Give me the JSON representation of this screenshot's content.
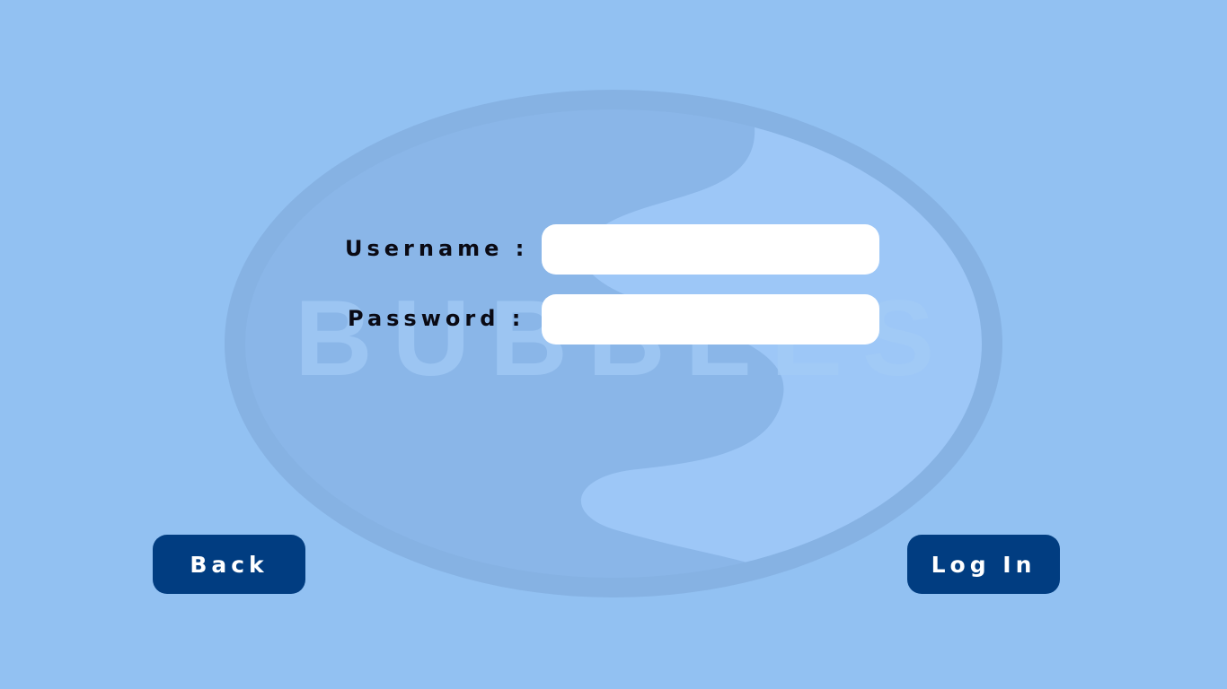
{
  "logo": {
    "wordmark": "BUBBLES"
  },
  "colors": {
    "background": "#92c1f2",
    "logo_ring": "#86b2e3",
    "logo_dark_half": "#8ab6e8",
    "logo_light_half": "#9dc7f7",
    "button": "#013d81",
    "button_text": "#ffffff",
    "field": "#ffffff",
    "label_text": "#0a0a14"
  },
  "login_form": {
    "username_label": "Username :",
    "username_value": "",
    "password_label": "Password :",
    "password_value": ""
  },
  "buttons": {
    "back_label": "Back",
    "login_label": "Log In"
  }
}
